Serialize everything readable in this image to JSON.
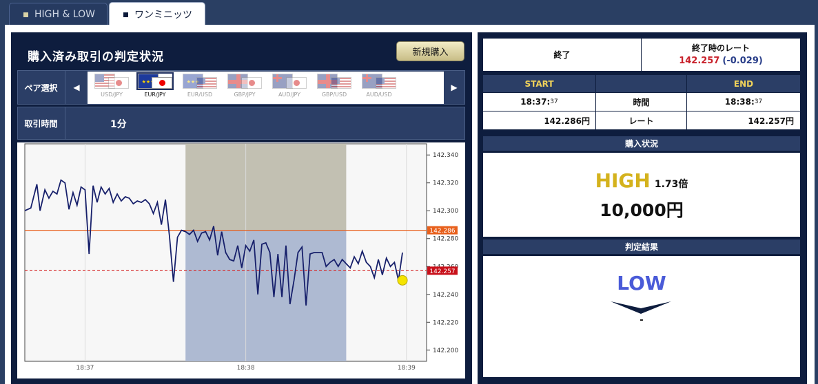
{
  "tabs": [
    {
      "label": "HIGH & LOW"
    },
    {
      "label": "ワンミニッツ"
    }
  ],
  "left": {
    "title": "購入済み取引の判定状況",
    "new_button": "新規購入",
    "pair_label": "ペア選択",
    "pairs": [
      "USD/JPY",
      "EUR/JPY",
      "EUR/USD",
      "GBP/JPY",
      "AUD/JPY",
      "GBP/USD",
      "AUD/USD"
    ],
    "selected_pair": "EUR/JPY",
    "time_label": "取引時間",
    "time_value": "1分"
  },
  "chart_data": {
    "type": "line",
    "title": "",
    "y_ticks": [
      "142.340",
      "142.320",
      "142.300",
      "142.280",
      "142.260",
      "142.240",
      "142.220",
      "142.200"
    ],
    "x_ticks": [
      "18:37",
      "18:38",
      "18:39"
    ],
    "ylim": [
      142.192,
      142.348
    ],
    "xlim": [
      0,
      100
    ],
    "start_rate_label": "142.286",
    "current_rate_label": "142.257",
    "start_rate": 142.286,
    "current_rate": 142.257,
    "series": [
      {
        "x": [
          0,
          1.5,
          3,
          3.8,
          5,
          6,
          7,
          8,
          9,
          10,
          11,
          12,
          13,
          14,
          15,
          16,
          17,
          18,
          19,
          20,
          21,
          22,
          23,
          24,
          25,
          26,
          27,
          28,
          29,
          30,
          31,
          32,
          33,
          34,
          35,
          36,
          37,
          38,
          39,
          40,
          41,
          42,
          43,
          44,
          45,
          46,
          47,
          48,
          49,
          50,
          51,
          52,
          53,
          54,
          55,
          56,
          57,
          58,
          59,
          60,
          61,
          62,
          63,
          64,
          65,
          66,
          67,
          68,
          69,
          70,
          71,
          72,
          73,
          74,
          75,
          76,
          77,
          78,
          79,
          80,
          81,
          82,
          83,
          84,
          85,
          86,
          87,
          88,
          89,
          90,
          91,
          92,
          93,
          94
        ],
        "values": [
          142.3,
          142.302,
          142.319,
          142.3,
          142.315,
          142.309,
          142.314,
          142.312,
          142.322,
          142.32,
          142.301,
          142.313,
          142.304,
          142.317,
          142.315,
          142.269,
          142.318,
          142.306,
          142.317,
          142.312,
          142.316,
          142.306,
          142.312,
          142.307,
          142.31,
          142.309,
          142.305,
          142.307,
          142.306,
          142.308,
          142.305,
          142.298,
          142.306,
          142.29,
          142.308,
          142.282,
          142.249,
          142.281,
          142.286,
          142.285,
          142.283,
          142.286,
          142.278,
          142.284,
          142.285,
          142.279,
          142.289,
          142.268,
          142.285,
          142.27,
          142.265,
          142.264,
          142.275,
          142.259,
          142.275,
          142.271,
          142.279,
          142.24,
          142.276,
          142.277,
          142.27,
          142.238,
          142.269,
          142.238,
          142.275,
          142.233,
          142.25,
          142.27,
          142.274,
          142.232,
          142.269,
          142.27,
          142.27,
          142.27,
          142.26,
          142.263,
          142.265,
          142.26,
          142.265,
          142.262,
          142.259,
          142.267,
          142.262,
          142.271,
          142.263,
          142.26,
          142.252,
          142.265,
          142.254,
          142.266,
          142.26,
          142.263,
          142.25,
          142.27
        ]
      }
    ]
  },
  "right": {
    "status": "終了",
    "end_rate_label": "終了時のレート",
    "end_rate": "142.257",
    "end_rate_change": "(-0.029)",
    "col_start": "START",
    "col_end": "END",
    "time_row_label": "時間",
    "rate_row_label": "レート",
    "start_time_main": "18:37:",
    "start_time_sec": "37",
    "end_time_main": "18:38:",
    "end_time_sec": "37",
    "start_rate": "142.286円",
    "end_rate_value": "142.257円",
    "purchase_header": "購入状況",
    "purchase_direction": "HIGH",
    "payout": "1.73倍",
    "amount": "10,000円",
    "result_header": "判定結果",
    "result": "LOW",
    "result_sub": "-"
  },
  "colors": {
    "navy": "#0e1d3e",
    "header_gold": "#f0d25a",
    "high_gold": "#d4b21d",
    "low_blue": "#4a5bd8",
    "rate_red": "#c8202a",
    "start_orange": "#e8601c"
  }
}
